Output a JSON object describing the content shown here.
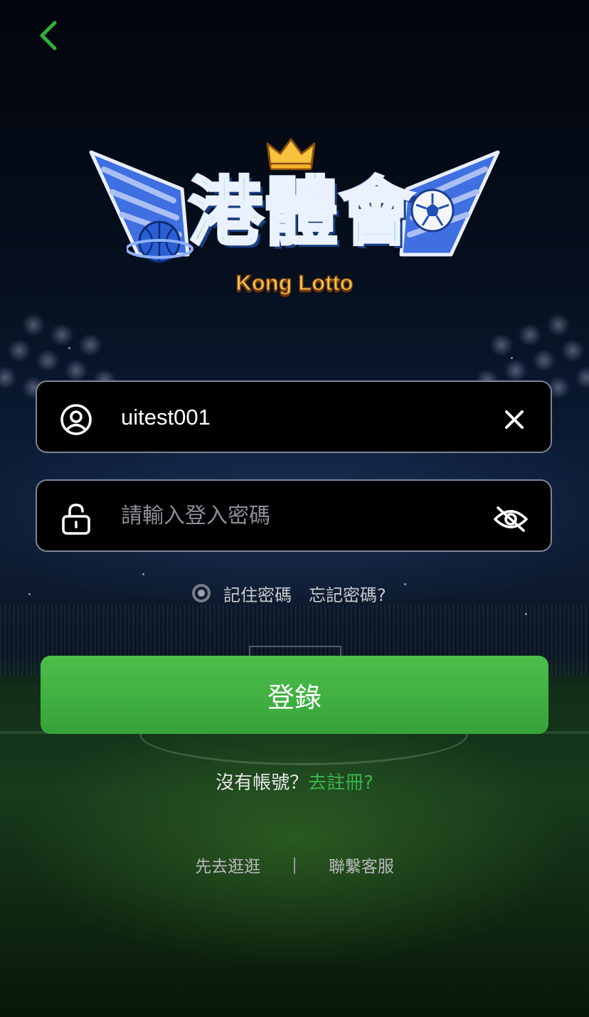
{
  "nav": {
    "back_icon": "chevron-left-icon",
    "accent": "#2fb13b"
  },
  "logo": {
    "title": "港體會",
    "subtitle": "Kong Lotto",
    "crown_icon": "crown-icon",
    "basketball_icon": "basketball-icon",
    "soccer_ball_icon": "soccer-ball-icon"
  },
  "login_form": {
    "username": {
      "value": "uitest001",
      "icon": "user-icon",
      "clear_icon": "close-icon"
    },
    "password": {
      "value": "",
      "placeholder": "請輸入登入密碼",
      "icon": "lock-icon",
      "toggle_icon": "eye-off-icon"
    },
    "remember_label": "記住密碼",
    "forgot_label": "忘記密碼?",
    "submit_label": "登錄",
    "submit_color": "#3fb143"
  },
  "register": {
    "prompt": "沒有帳號？",
    "link": "去註冊?"
  },
  "footer": {
    "browse": "先去逛逛",
    "separator": "|",
    "support": "聯繫客服"
  }
}
